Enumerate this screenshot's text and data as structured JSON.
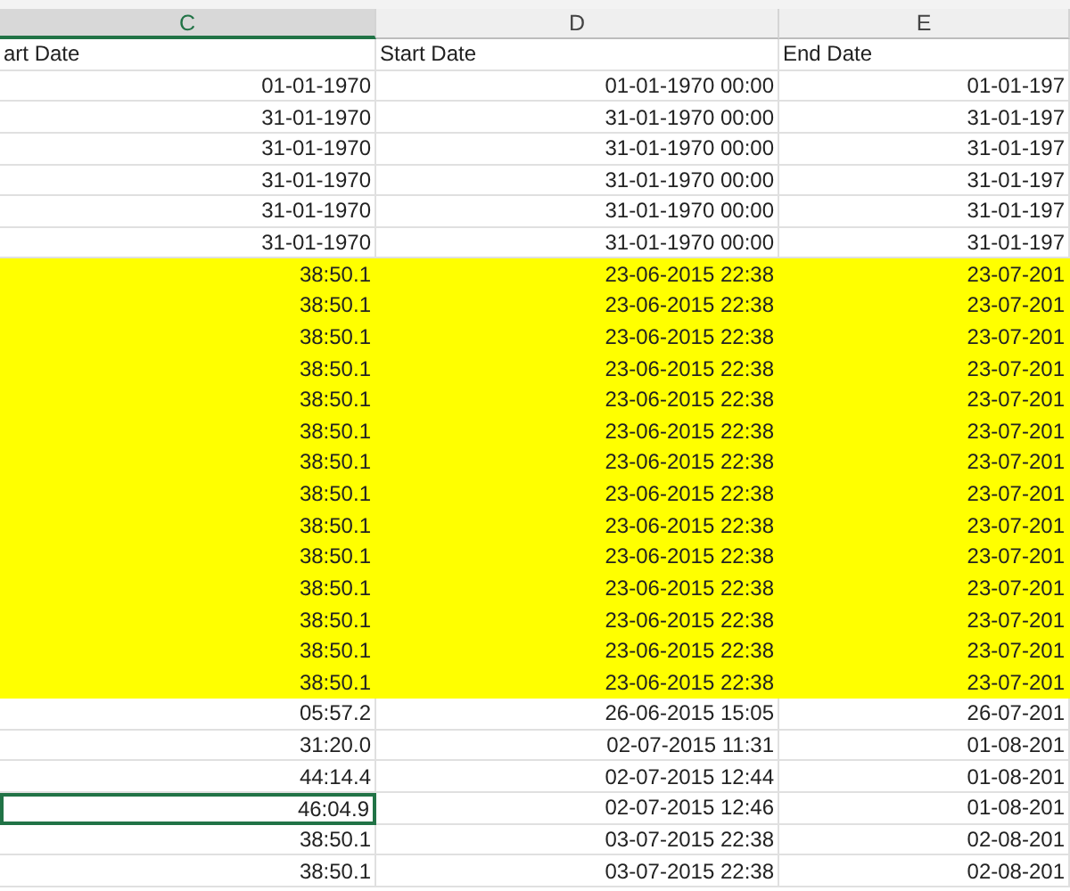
{
  "columns": [
    {
      "label": "C",
      "selected": true
    },
    {
      "label": "D",
      "selected": false
    },
    {
      "label": "E",
      "selected": false
    }
  ],
  "header_row": [
    "art Date",
    "Start Date",
    "End Date"
  ],
  "rows": [
    {
      "c": "01-01-1970",
      "d": "01-01-1970 00:00",
      "e": "01-01-197",
      "highlighted": false,
      "selected": false
    },
    {
      "c": "31-01-1970",
      "d": "31-01-1970 00:00",
      "e": "31-01-197",
      "highlighted": false,
      "selected": false
    },
    {
      "c": "31-01-1970",
      "d": "31-01-1970 00:00",
      "e": "31-01-197",
      "highlighted": false,
      "selected": false
    },
    {
      "c": "31-01-1970",
      "d": "31-01-1970 00:00",
      "e": "31-01-197",
      "highlighted": false,
      "selected": false
    },
    {
      "c": "31-01-1970",
      "d": "31-01-1970 00:00",
      "e": "31-01-197",
      "highlighted": false,
      "selected": false
    },
    {
      "c": "31-01-1970",
      "d": "31-01-1970 00:00",
      "e": "31-01-197",
      "highlighted": false,
      "selected": false
    },
    {
      "c": "38:50.1",
      "d": "23-06-2015 22:38",
      "e": "23-07-201",
      "highlighted": true,
      "selected": false
    },
    {
      "c": "38:50.1",
      "d": "23-06-2015 22:38",
      "e": "23-07-201",
      "highlighted": true,
      "selected": false
    },
    {
      "c": "38:50.1",
      "d": "23-06-2015 22:38",
      "e": "23-07-201",
      "highlighted": true,
      "selected": false
    },
    {
      "c": "38:50.1",
      "d": "23-06-2015 22:38",
      "e": "23-07-201",
      "highlighted": true,
      "selected": false
    },
    {
      "c": "38:50.1",
      "d": "23-06-2015 22:38",
      "e": "23-07-201",
      "highlighted": true,
      "selected": false
    },
    {
      "c": "38:50.1",
      "d": "23-06-2015 22:38",
      "e": "23-07-201",
      "highlighted": true,
      "selected": false
    },
    {
      "c": "38:50.1",
      "d": "23-06-2015 22:38",
      "e": "23-07-201",
      "highlighted": true,
      "selected": false
    },
    {
      "c": "38:50.1",
      "d": "23-06-2015 22:38",
      "e": "23-07-201",
      "highlighted": true,
      "selected": false
    },
    {
      "c": "38:50.1",
      "d": "23-06-2015 22:38",
      "e": "23-07-201",
      "highlighted": true,
      "selected": false
    },
    {
      "c": "38:50.1",
      "d": "23-06-2015 22:38",
      "e": "23-07-201",
      "highlighted": true,
      "selected": false
    },
    {
      "c": "38:50.1",
      "d": "23-06-2015 22:38",
      "e": "23-07-201",
      "highlighted": true,
      "selected": false
    },
    {
      "c": "38:50.1",
      "d": "23-06-2015 22:38",
      "e": "23-07-201",
      "highlighted": true,
      "selected": false
    },
    {
      "c": "38:50.1",
      "d": "23-06-2015 22:38",
      "e": "23-07-201",
      "highlighted": true,
      "selected": false
    },
    {
      "c": "38:50.1",
      "d": "23-06-2015 22:38",
      "e": "23-07-201",
      "highlighted": true,
      "selected": false
    },
    {
      "c": "05:57.2",
      "d": "26-06-2015 15:05",
      "e": "26-07-201",
      "highlighted": false,
      "selected": false
    },
    {
      "c": "31:20.0",
      "d": "02-07-2015 11:31",
      "e": "01-08-201",
      "highlighted": false,
      "selected": false
    },
    {
      "c": "44:14.4",
      "d": "02-07-2015 12:44",
      "e": "01-08-201",
      "highlighted": false,
      "selected": false
    },
    {
      "c": "46:04.9",
      "d": "02-07-2015 12:46",
      "e": "01-08-201",
      "highlighted": false,
      "selected": true
    },
    {
      "c": "38:50.1",
      "d": "03-07-2015 22:38",
      "e": "02-08-201",
      "highlighted": false,
      "selected": false
    },
    {
      "c": "38:50.1",
      "d": "03-07-2015 22:38",
      "e": "02-08-201",
      "highlighted": false,
      "selected": false
    }
  ]
}
